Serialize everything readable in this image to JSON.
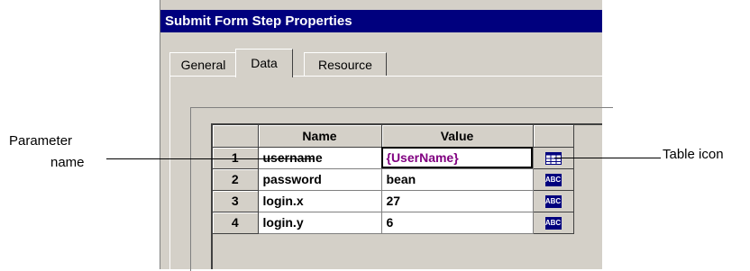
{
  "dialog": {
    "title": "Submit Form Step Properties"
  },
  "tabs": [
    {
      "label": "General",
      "active": false
    },
    {
      "label": "Data",
      "active": true
    },
    {
      "label": "Resource",
      "active": false
    }
  ],
  "grid": {
    "columns": [
      "",
      "Name",
      "Value",
      ""
    ],
    "rows": [
      {
        "num": "1",
        "name": "username",
        "value": "{UserName}",
        "icon": "table-icon"
      },
      {
        "num": "2",
        "name": "password",
        "value": "bean",
        "icon": "abc-icon"
      },
      {
        "num": "3",
        "name": "login.x",
        "value": "27",
        "icon": "abc-icon"
      },
      {
        "num": "4",
        "name": "login.y",
        "value": "6",
        "icon": "abc-icon"
      }
    ],
    "abc_text": "ABC"
  },
  "callouts": {
    "param_line1": "Parameter",
    "param_line2": "name",
    "table_icon": "Table icon"
  },
  "colors": {
    "titlebar": "#00007e",
    "selected_value": "#800080",
    "abc_icon_bg": "#00007e"
  }
}
